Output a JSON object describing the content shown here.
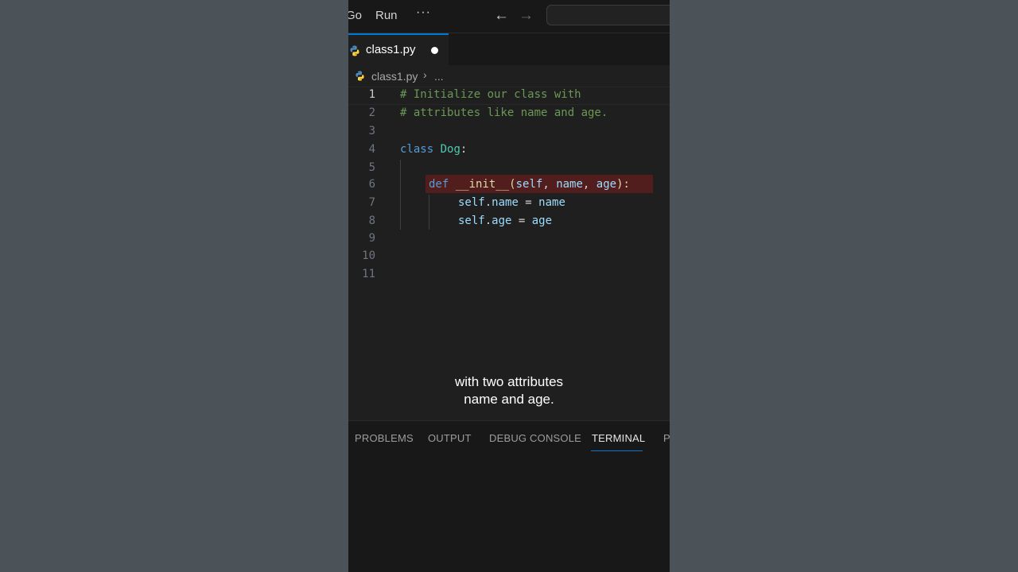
{
  "menubar": {
    "items": [
      "Go",
      "Run"
    ],
    "more": "···",
    "back_arrow": "←",
    "forward_arrow": "→"
  },
  "tabs": [
    {
      "label": "class1.py",
      "icon": "python-icon",
      "modified": true
    }
  ],
  "breadcrumb": {
    "file": "class1.py",
    "separator": "›",
    "more": "..."
  },
  "editor": {
    "lines": [
      {
        "n": "1",
        "text": "# Initialize our class with"
      },
      {
        "n": "2",
        "text": "# attributes like name and age."
      },
      {
        "n": "3",
        "text": ""
      },
      {
        "n": "4",
        "text": "class Dog:"
      },
      {
        "n": "5",
        "text": ""
      },
      {
        "n": "6",
        "text": "    def __init__(self, name, age):"
      },
      {
        "n": "7",
        "text": "        self.name = name"
      },
      {
        "n": "8",
        "text": "        self.age = age"
      },
      {
        "n": "9",
        "text": ""
      },
      {
        "n": "10",
        "text": ""
      },
      {
        "n": "11",
        "text": ""
      }
    ],
    "current_line": "1",
    "highlighted_line": "6"
  },
  "tokens": {
    "l1": "# Initialize our class with",
    "l2": "# attributes like name and age.",
    "l4_kw": "class",
    "l4_name": "Dog",
    "l4_colon": ":",
    "l6_kw": "def",
    "l6_fn": "__init__",
    "l6_open": "(",
    "l6_self": "self",
    "l6_c1": ", ",
    "l6_name": "name",
    "l6_c2": ", ",
    "l6_age": "age",
    "l6_close": "):",
    "l7_self": "self",
    "l7_dot": ".",
    "l7_attr": "name",
    "l7_eq": " = ",
    "l7_val": "name",
    "l8_self": "self",
    "l8_dot": ".",
    "l8_attr": "age",
    "l8_eq": " = ",
    "l8_val": "age"
  },
  "subtitle": {
    "line1": "with two attributes",
    "line2": "name and age."
  },
  "panel": {
    "tabs": [
      "PROBLEMS",
      "OUTPUT",
      "DEBUG CONSOLE",
      "TERMINAL",
      "PORTS"
    ],
    "active": "TERMINAL"
  },
  "colors": {
    "editor_bg": "#1f1f1f",
    "comment": "#6a9955",
    "keyword": "#569cd6",
    "class_name": "#4ec9b0",
    "function": "#dcdcaa",
    "variable": "#9cdcfe",
    "accent": "#0078d4",
    "highlight": "#5a1d1d"
  }
}
